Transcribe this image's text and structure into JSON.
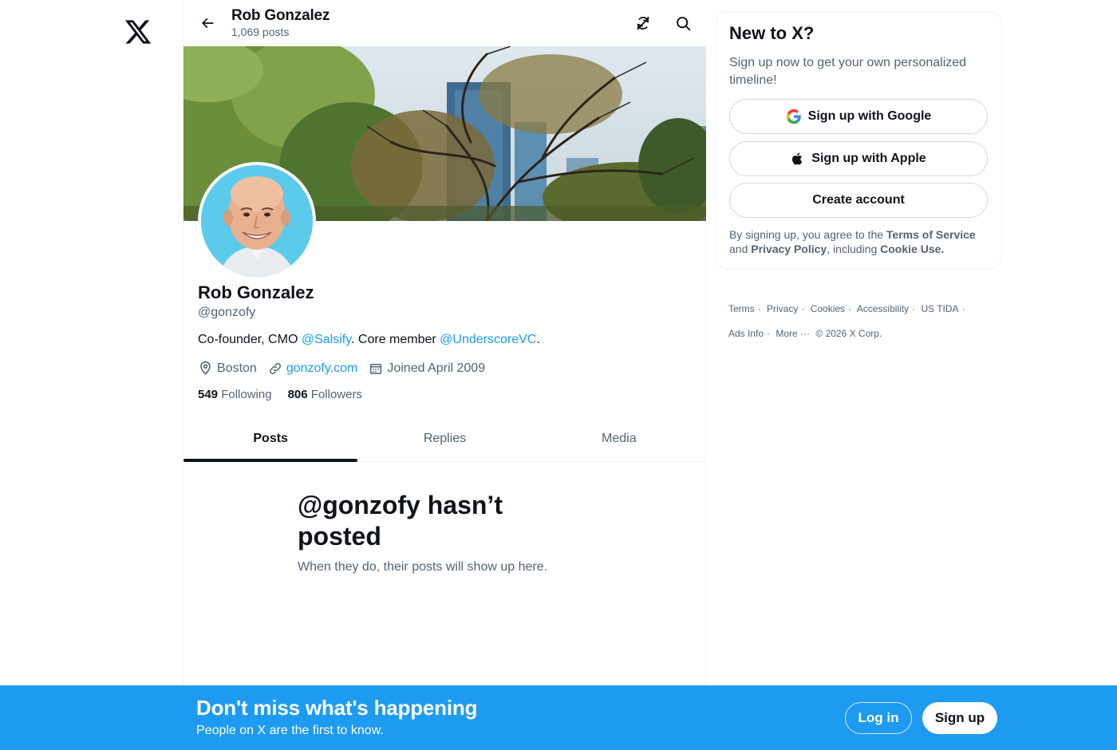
{
  "nav": {
    "logo_icon": "x-logo-icon"
  },
  "header": {
    "name": "Rob Gonzalez",
    "post_count": "1,069 posts",
    "back_icon": "arrow-left-icon",
    "icons": [
      "refresh-icon",
      "search-icon"
    ]
  },
  "profile": {
    "name": "Rob Gonzalez",
    "handle": "@gonzofy",
    "bio": {
      "part1": "Co-founder, CMO ",
      "mention1": "@Salsify",
      "part2": ". Core member ",
      "mention2": "@UnderscoreVC",
      "part3": "."
    },
    "location": "Boston",
    "website": "gonzofy.com",
    "joined": "Joined April 2009",
    "following_count": "549",
    "following_label": "Following",
    "followers_count": "806",
    "followers_label": "Followers"
  },
  "tabs": [
    {
      "label": "Posts",
      "active": true
    },
    {
      "label": "Replies",
      "active": false
    },
    {
      "label": "Media",
      "active": false
    }
  ],
  "empty_state": {
    "title": "@gonzofy hasn’t posted",
    "subtitle": "When they do, their posts will show up here."
  },
  "signup_card": {
    "title": "New to X?",
    "subtitle": "Sign up now to get your own personalized timeline!",
    "google_label": "Sign up with Google",
    "apple_label": "Sign up with Apple",
    "create_label": "Create account",
    "terms": {
      "t1": "By signing up, you agree to the ",
      "tos": "Terms of Service",
      "t2": " and ",
      "privacy": "Privacy Policy",
      "t3": ", including ",
      "cookie": "Cookie Use."
    }
  },
  "footer": {
    "links": [
      "Terms",
      "Privacy",
      "Cookies",
      "Accessibility",
      "US TIDA",
      "Ads Info",
      "More ···",
      "© 2026 X Corp."
    ]
  },
  "bottom_bar": {
    "title": "Don't miss what's happening",
    "subtitle": "People on X are the first to know.",
    "login_label": "Log in",
    "signup_label": "Sign up"
  },
  "colors": {
    "accent": "#1d9bf0",
    "text_primary": "#0f1419",
    "text_secondary": "#536471"
  }
}
